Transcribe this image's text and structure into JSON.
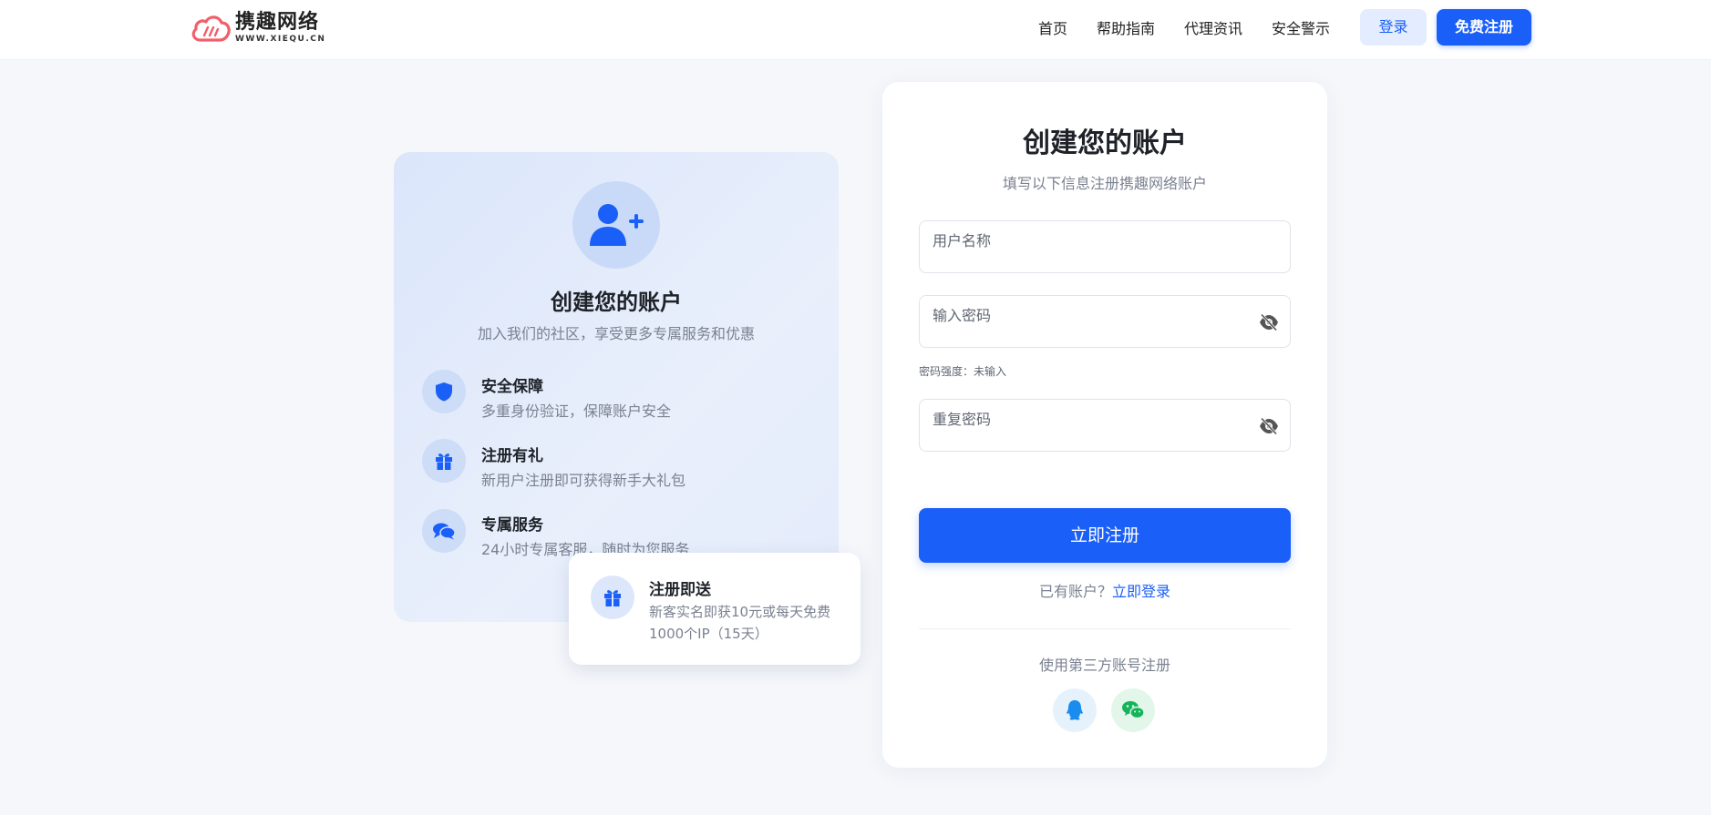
{
  "header": {
    "logo": {
      "name": "携趣网络",
      "url": "WWW.XIEQU.CN"
    },
    "nav": [
      "首页",
      "帮助指南",
      "代理资讯",
      "安全警示"
    ],
    "login_label": "登录",
    "register_label": "免费注册"
  },
  "left_panel": {
    "title": "创建您的账户",
    "subtitle": "加入我们的社区，享受更多专属服务和优惠",
    "features": [
      {
        "icon": "shield-icon",
        "title": "安全保障",
        "desc": "多重身份验证，保障账户安全"
      },
      {
        "icon": "gift-icon",
        "title": "注册有礼",
        "desc": "新用户注册即可获得新手大礼包"
      },
      {
        "icon": "chat-icon",
        "title": "专属服务",
        "desc": "24小时专属客服，随时为您服务"
      }
    ],
    "promo": {
      "icon": "gift-icon",
      "title": "注册即送",
      "desc": "新客实名即获10元或每天免费1000个IP（15天）"
    }
  },
  "form": {
    "title": "创建您的账户",
    "subtitle": "填写以下信息注册携趣网络账户",
    "username_placeholder": "用户名称",
    "password_placeholder": "输入密码",
    "password_strength": "密码强度：未输入",
    "confirm_placeholder": "重复密码",
    "submit_label": "立即注册",
    "have_account": "已有账户？",
    "login_link": "立即登录",
    "third_party_label": "使用第三方账号注册",
    "social": [
      {
        "icon": "qq-icon",
        "bg": "#e6f2fb",
        "color": "#1a8cf0"
      },
      {
        "icon": "wechat-icon",
        "bg": "#e3f6ea",
        "color": "#14b45a"
      }
    ]
  },
  "colors": {
    "primary": "#1a5ff7",
    "logo_red": "#f0606a"
  }
}
